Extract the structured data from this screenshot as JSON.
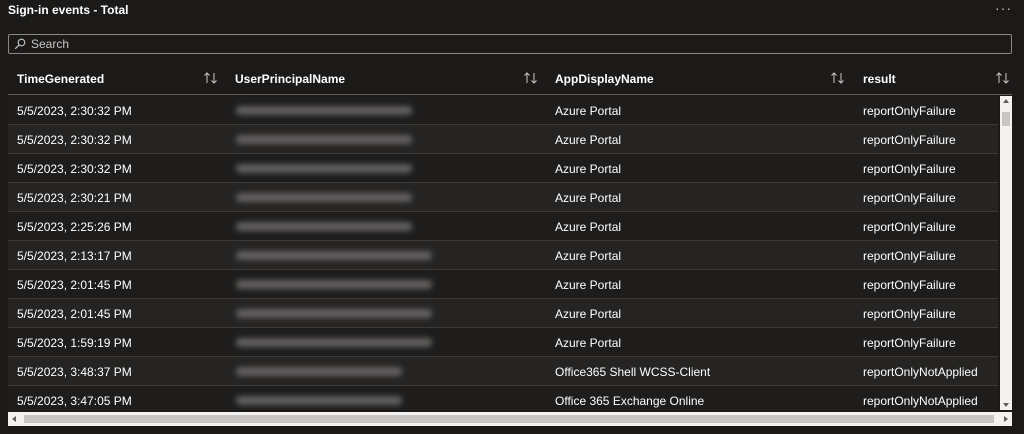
{
  "panel": {
    "title": "Sign-in events - Total",
    "more_icon": "ellipsis-icon",
    "more_label": "···"
  },
  "search": {
    "placeholder": "Search",
    "value": "",
    "icon": "search-icon"
  },
  "table": {
    "columns": [
      {
        "label": "TimeGenerated",
        "sort_icon": "sort-icon"
      },
      {
        "label": "UserPrincipalName",
        "sort_icon": "sort-icon"
      },
      {
        "label": "AppDisplayName",
        "sort_icon": "sort-icon"
      },
      {
        "label": "result",
        "sort_icon": "sort-icon"
      }
    ],
    "rows": [
      {
        "time": "5/5/2023, 2:30:32 PM",
        "user": "",
        "app": "Azure Portal",
        "result": "reportOnlyFailure"
      },
      {
        "time": "5/5/2023, 2:30:32 PM",
        "user": "",
        "app": "Azure Portal",
        "result": "reportOnlyFailure"
      },
      {
        "time": "5/5/2023, 2:30:32 PM",
        "user": "",
        "app": "Azure Portal",
        "result": "reportOnlyFailure"
      },
      {
        "time": "5/5/2023, 2:30:21 PM",
        "user": "",
        "app": "Azure Portal",
        "result": "reportOnlyFailure"
      },
      {
        "time": "5/5/2023, 2:25:26 PM",
        "user": "",
        "app": "Azure Portal",
        "result": "reportOnlyFailure"
      },
      {
        "time": "5/5/2023, 2:13:17 PM",
        "user": "",
        "app": "Azure Portal",
        "result": "reportOnlyFailure"
      },
      {
        "time": "5/5/2023, 2:01:45 PM",
        "user": "",
        "app": "Azure Portal",
        "result": "reportOnlyFailure"
      },
      {
        "time": "5/5/2023, 2:01:45 PM",
        "user": "",
        "app": "Azure Portal",
        "result": "reportOnlyFailure"
      },
      {
        "time": "5/5/2023, 1:59:19 PM",
        "user": "",
        "app": "Azure Portal",
        "result": "reportOnlyFailure"
      },
      {
        "time": "5/5/2023, 3:48:37 PM",
        "user": "",
        "app": "Office365 Shell WCSS-Client",
        "result": "reportOnlyNotApplied"
      },
      {
        "time": "5/5/2023, 3:47:05 PM",
        "user": "",
        "app": "Office 365 Exchange Online",
        "result": "reportOnlyNotApplied"
      }
    ]
  },
  "colors": {
    "background": "#1b1a19",
    "row_odd": "#1e1d1c",
    "row_even": "#252423",
    "text": "#ffffff",
    "border": "#8a8886"
  }
}
